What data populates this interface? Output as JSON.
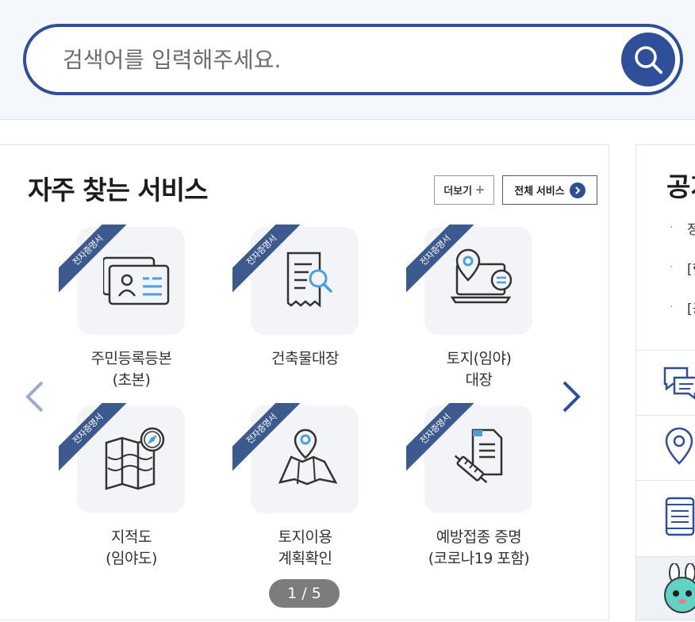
{
  "search": {
    "placeholder": "검색어를 입력해주세요."
  },
  "services": {
    "title": "자주 찾는 서비스",
    "more_label": "더보기",
    "all_label": "전체 서비스",
    "badge": "전자증명서",
    "tiles": [
      {
        "line1": "주민등록등본",
        "line2": "(초본)"
      },
      {
        "line1": "건축물대장",
        "line2": ""
      },
      {
        "line1": "토지(임야)",
        "line2": "대장"
      },
      {
        "line1": "지적도",
        "line2": "(임야도)"
      },
      {
        "line1": "토지이용",
        "line2": "계획확인"
      },
      {
        "line1": "예방접종 증명",
        "line2": "(코로나19 포함)"
      }
    ],
    "pager": "1 / 5"
  },
  "right_panel": {
    "title": "공지",
    "items": [
      "정",
      "[한",
      "[공"
    ]
  },
  "colors": {
    "primary": "#2f4f9a",
    "ribbon": "#3d5a8f",
    "accent": "#4a9fdc"
  }
}
